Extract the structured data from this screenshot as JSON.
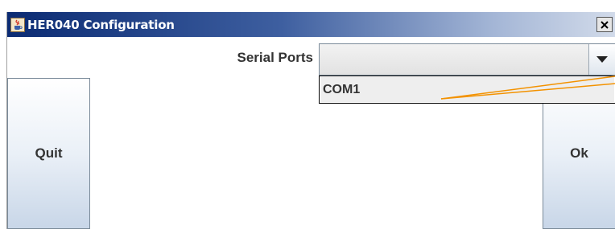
{
  "window": {
    "title": "HER040 Configuration"
  },
  "form": {
    "serial_ports_label": "Serial Ports",
    "serial_ports_selected": "",
    "serial_ports_options": [
      "COM1"
    ]
  },
  "buttons": {
    "quit_label": "Quit",
    "ok_label": "Ok"
  },
  "colors": {
    "titlebar_dark": "#0b2b73",
    "titlebar_light": "#d2dbea",
    "annotation_line": "#f39200"
  },
  "icons": {
    "app": "java-cup-icon",
    "close": "close-icon",
    "dropdown": "chevron-down-icon"
  }
}
